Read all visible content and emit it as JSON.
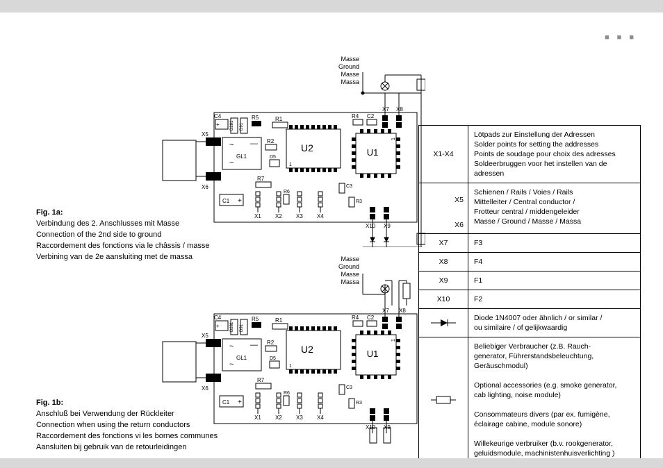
{
  "corner_marks": "■ ■ ■",
  "diagram_common": {
    "rail_labels": [
      "Schienen",
      "Rails",
      "Voies",
      "Rails"
    ],
    "ground_labels": [
      "Masse",
      "Ground",
      "Masse",
      "Massa"
    ],
    "chips": {
      "u1": "U1",
      "u2": "U2",
      "gl1": "GL1"
    },
    "components": {
      "c1": "C1",
      "c2": "C2",
      "c3": "C3",
      "c4": "C4",
      "r1": "R1",
      "r2": "R2",
      "r3": "R3",
      "r4": "R4",
      "r5": "R5",
      "r6": "R6",
      "r7": "R7",
      "d5": "D5"
    },
    "pads": {
      "x1": "X1",
      "x2": "X2",
      "x3": "X3",
      "x4": "X4",
      "x5": "X5",
      "x6": "X6",
      "x7": "X7",
      "x8": "X8",
      "x9": "X9",
      "x10": "X10"
    },
    "d_labels": {
      "d281": "D281",
      "d91": "D91"
    }
  },
  "fig1a": {
    "title": "Fig. 1a:",
    "lines": [
      "Verbindung des 2. Anschlusses mit Masse",
      "Connection of the 2nd side to ground",
      "Raccordement des fonctions via le châssis / masse",
      "Verbining van de 2e aansluiting met de massa"
    ]
  },
  "fig1b": {
    "title": "Fig. 1b:",
    "lines": [
      "Anschluß bei Verwendung der Rückleiter",
      "Connection when using the return conductors",
      "Raccordement des fonctions vi les bornes communes",
      "Aansluiten bij gebruik van de retourleidingen"
    ]
  },
  "legend": [
    {
      "key": "X1-X4",
      "lines": [
        "Lötpads zur Einstellung der Adressen",
        "Solder points for setting the addresses",
        "Points de soudage pour choix des adresses",
        "Soldeerbruggen voor het instellen van de adressen"
      ]
    },
    {
      "key_multi": [
        "",
        "X5",
        "",
        "X6"
      ],
      "lines": [
        "Schienen / Rails / Voies / Rails",
        "Mittelleiter / Central conductor /",
        "Frotteur central / middengeleider",
        "Masse / Ground / Masse / Massa"
      ]
    },
    {
      "key": "X7",
      "lines": [
        "F3"
      ]
    },
    {
      "key": "X8",
      "lines": [
        "F4"
      ]
    },
    {
      "key": "X9",
      "lines": [
        "F1"
      ]
    },
    {
      "key": "X10",
      "lines": [
        "F2"
      ]
    },
    {
      "symbol": "diode",
      "lines": [
        "Diode 1N4007 oder ähnlich / or similar /",
        "ou similaire / of gelijkwaardig"
      ]
    },
    {
      "symbol": "resistor",
      "lines": [
        "Beliebiger Verbraucher (z.B. Rauch-",
        "generator, Führerstandsbeleuchtung,",
        "Geräuschmodul)",
        "",
        "Optional accessories (e.g. smoke generator,",
        "cab lighting, noise module)",
        "",
        "Consommateurs divers (par ex. fumigène,",
        "éclairage cabine, module sonore)",
        "",
        "Willekeurige verbruiker (b.v. rookgenerator,",
        "geluidsmodule, machinistenhuisverlichting )"
      ]
    }
  ]
}
